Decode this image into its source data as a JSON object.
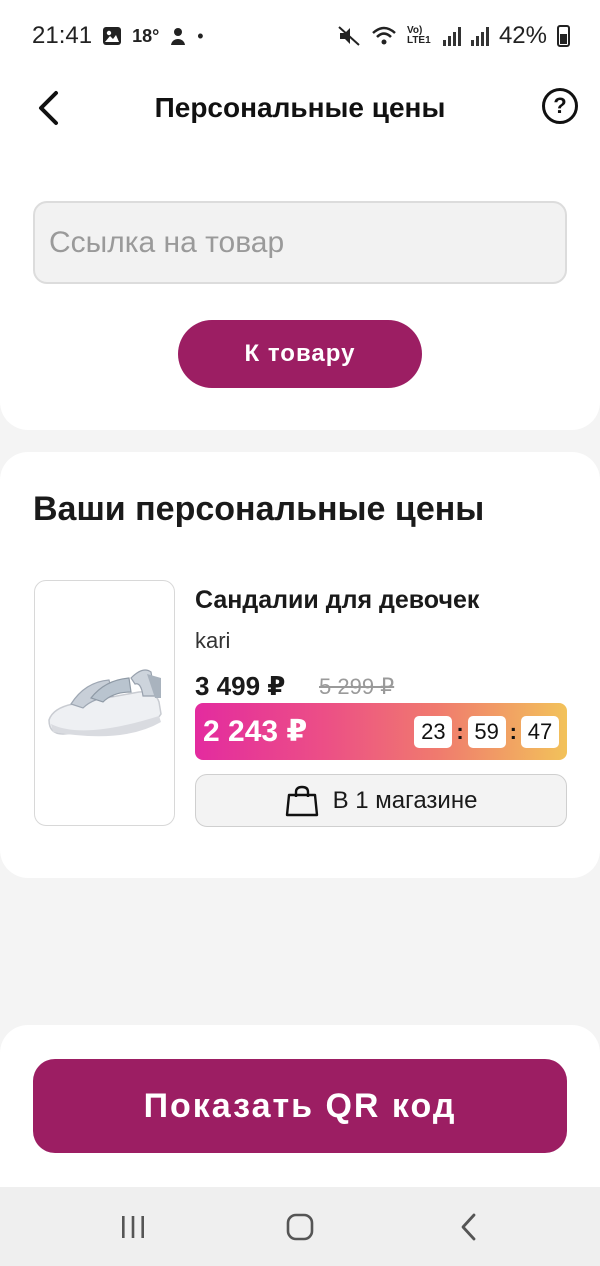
{
  "status_bar": {
    "time": "21:41",
    "temperature": "18°",
    "battery": "42%",
    "network": "Vo) LTE1"
  },
  "header": {
    "title": "Персональные цены"
  },
  "search": {
    "placeholder": "Ссылка на товар",
    "value": ""
  },
  "to_product_button": "К товару",
  "section_title": "Ваши персональные цены",
  "product": {
    "name": "Сандалии для девочек",
    "brand": "kari",
    "price_current": "3 499 ₽",
    "price_old": "5 299 ₽",
    "personal_price": "2 243 ₽",
    "timer": {
      "hours": "23",
      "minutes": "59",
      "seconds": "47"
    },
    "stores_label": "В 1 магазине"
  },
  "qr_button": "Показать QR код",
  "colors": {
    "accent": "#9c1e63",
    "gradient_start": "#e32b9f",
    "gradient_end": "#f2c25a"
  }
}
